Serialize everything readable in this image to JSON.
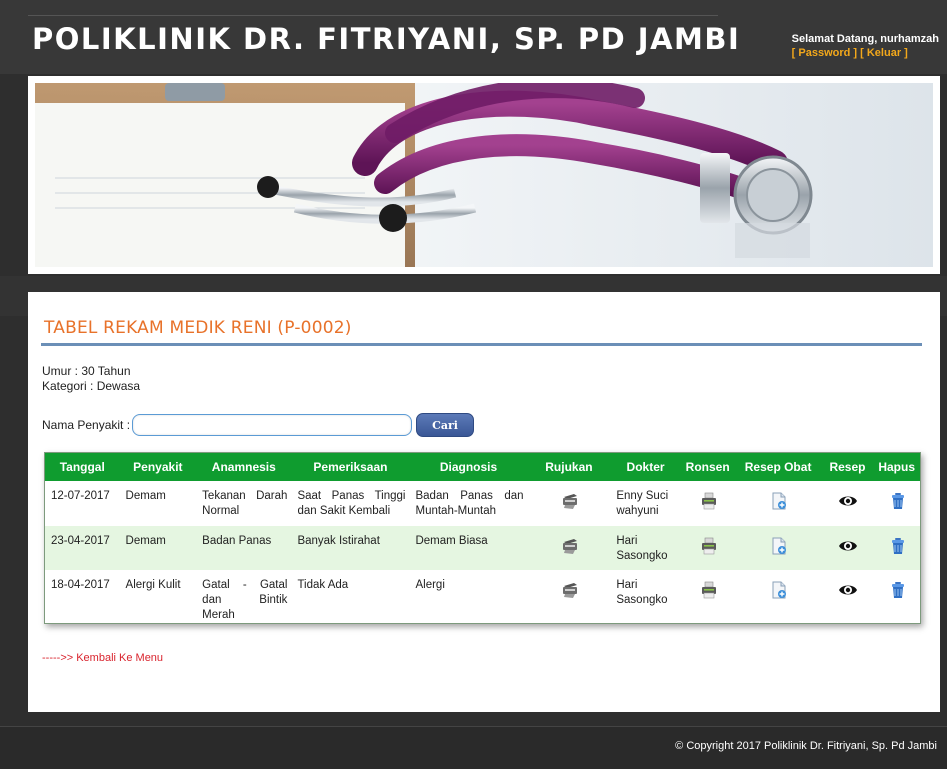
{
  "header": {
    "title": "POLIKLINIK DR. FITRIYANI, SP. PD JAMBI",
    "welcome": "Selamat Datang, nurhamzah",
    "password_link": "[ Password ]",
    "logout_link": "[ Keluar ]"
  },
  "page": {
    "heading": "TABEL REKAM MEDIK RENI (P-0002)",
    "age": "Umur : 30 Tahun",
    "category": "Kategori : Dewasa",
    "back_link": "----->> Kembali Ke Menu"
  },
  "search": {
    "label": "Nama Penyakit :",
    "value": "",
    "placeholder": "",
    "button": "Cari"
  },
  "table": {
    "columns": [
      "Tanggal",
      "Penyakit",
      "Anamnesis",
      "Pemeriksaan",
      "Diagnosis",
      "Rujukan",
      "Dokter",
      "Ronsen",
      "Resep Obat",
      "Resep",
      "Hapus"
    ],
    "rows": [
      {
        "tanggal": "12-07-2017",
        "penyakit": "Demam",
        "anamnesis": "Tekanan Darah Normal",
        "pemeriksaan": "Saat Panas Tinggi dan Sakit Kembali",
        "diagnosis": "Badan Panas dan Muntah-Muntah",
        "dokter": "Enny Suci wahyuni"
      },
      {
        "tanggal": "23-04-2017",
        "penyakit": "Demam",
        "anamnesis": "Badan Panas",
        "pemeriksaan": "Banyak Istirahat",
        "diagnosis": "Demam Biasa",
        "dokter": "Hari Sasongko"
      },
      {
        "tanggal": "18-04-2017",
        "penyakit": "Alergi Kulit",
        "anamnesis": "Gatal - Gatal dan Bintik Merah",
        "pemeriksaan": "Tidak Ada",
        "diagnosis": "Alergi",
        "dokter": "Hari Sasongko"
      }
    ],
    "icons": {
      "rujukan": "printer-icon",
      "ronsen": "xray-printer-icon",
      "resep_obat": "add-document-icon",
      "resep": "eye-icon",
      "hapus": "trash-icon"
    }
  },
  "footer": {
    "copyright": "© Copyright 2017 Poliklinik Dr. Fitriyani, Sp. Pd Jambi"
  },
  "colors": {
    "heading": "#e8722a",
    "table_header": "#0f9c2f",
    "row_alt": "#e5f6e1",
    "link": "#d9242e",
    "welcome_links": "#f3a81b"
  }
}
